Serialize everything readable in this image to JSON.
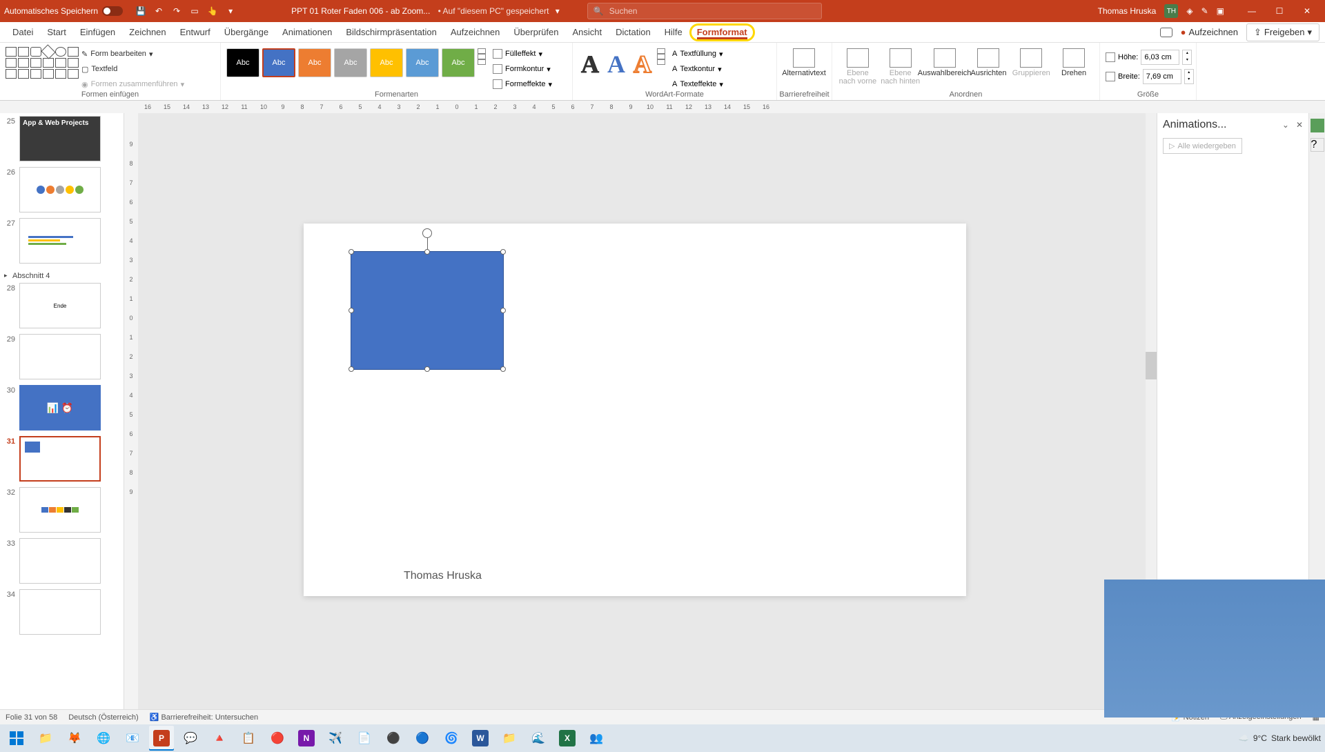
{
  "titlebar": {
    "autosave_label": "Automatisches Speichern",
    "doc_title": "PPT 01 Roter Faden 006 - ab Zoom...",
    "saved_status": "• Auf \"diesem PC\" gespeichert",
    "search_placeholder": "Suchen",
    "user_name": "Thomas Hruska",
    "user_initials": "TH"
  },
  "tabs": {
    "items": [
      "Datei",
      "Start",
      "Einfügen",
      "Zeichnen",
      "Entwurf",
      "Übergänge",
      "Animationen",
      "Bildschirmpräsentation",
      "Aufzeichnen",
      "Überprüfen",
      "Ansicht",
      "Dictation",
      "Hilfe",
      "Formformat"
    ],
    "active": "Formformat",
    "record_btn": "Aufzeichnen",
    "share_btn": "Freigeben"
  },
  "ribbon": {
    "insert_shapes": {
      "label": "Formen einfügen",
      "edit_shape": "Form bearbeiten",
      "textfield": "Textfeld",
      "merge": "Formen zusammenführen"
    },
    "shape_styles": {
      "label": "Formenarten",
      "swatch_text": "Abc",
      "fill": "Fülleffekt",
      "outline": "Formkontur",
      "effects": "Formeffekte"
    },
    "wordart": {
      "label": "WordArt-Formate",
      "textfill": "Textfüllung",
      "textoutline": "Textkontur",
      "texteffects": "Texteffekte"
    },
    "accessibility": {
      "label": "Barrierefreiheit",
      "alttext": "Alternativtext"
    },
    "arrange": {
      "label": "Anordnen",
      "forward": "Ebene nach vorne",
      "backward": "Ebene nach hinten",
      "selection": "Auswahlbereich",
      "align": "Ausrichten",
      "group": "Gruppieren",
      "rotate": "Drehen"
    },
    "size": {
      "label": "Größe",
      "height_label": "Höhe:",
      "height_value": "6,03 cm",
      "width_label": "Breite:",
      "width_value": "7,69 cm"
    }
  },
  "thumbnails": {
    "section4": "Abschnitt 4",
    "slides": [
      {
        "num": "25",
        "caption": "App & Web Projects"
      },
      {
        "num": "26",
        "caption": ""
      },
      {
        "num": "27",
        "caption": ""
      },
      {
        "num": "28",
        "caption": "Ende"
      },
      {
        "num": "29",
        "caption": ""
      },
      {
        "num": "30",
        "caption": ""
      },
      {
        "num": "31",
        "caption": ""
      },
      {
        "num": "32",
        "caption": ""
      },
      {
        "num": "33",
        "caption": ""
      },
      {
        "num": "34",
        "caption": ""
      }
    ]
  },
  "slide": {
    "author": "Thomas Hruska"
  },
  "animations_pane": {
    "title": "Animations...",
    "play_all": "Alle wiedergeben"
  },
  "statusbar": {
    "slide_info": "Folie 31 von 58",
    "language": "Deutsch (Österreich)",
    "accessibility": "Barrierefreiheit: Untersuchen",
    "notes": "Notizen",
    "display": "Anzeigeeinstellungen"
  },
  "ruler_h": [
    "16",
    "15",
    "14",
    "13",
    "12",
    "11",
    "10",
    "9",
    "8",
    "7",
    "6",
    "5",
    "4",
    "3",
    "2",
    "1",
    "0",
    "1",
    "2",
    "3",
    "4",
    "5",
    "6",
    "7",
    "8",
    "9",
    "10",
    "11",
    "12",
    "13",
    "14",
    "15",
    "16"
  ],
  "ruler_v": [
    "9",
    "8",
    "7",
    "6",
    "5",
    "4",
    "3",
    "2",
    "1",
    "0",
    "1",
    "2",
    "3",
    "4",
    "5",
    "6",
    "7",
    "8",
    "9"
  ],
  "taskbar": {
    "weather_temp": "9°C",
    "weather_desc": "Stark bewölkt"
  }
}
